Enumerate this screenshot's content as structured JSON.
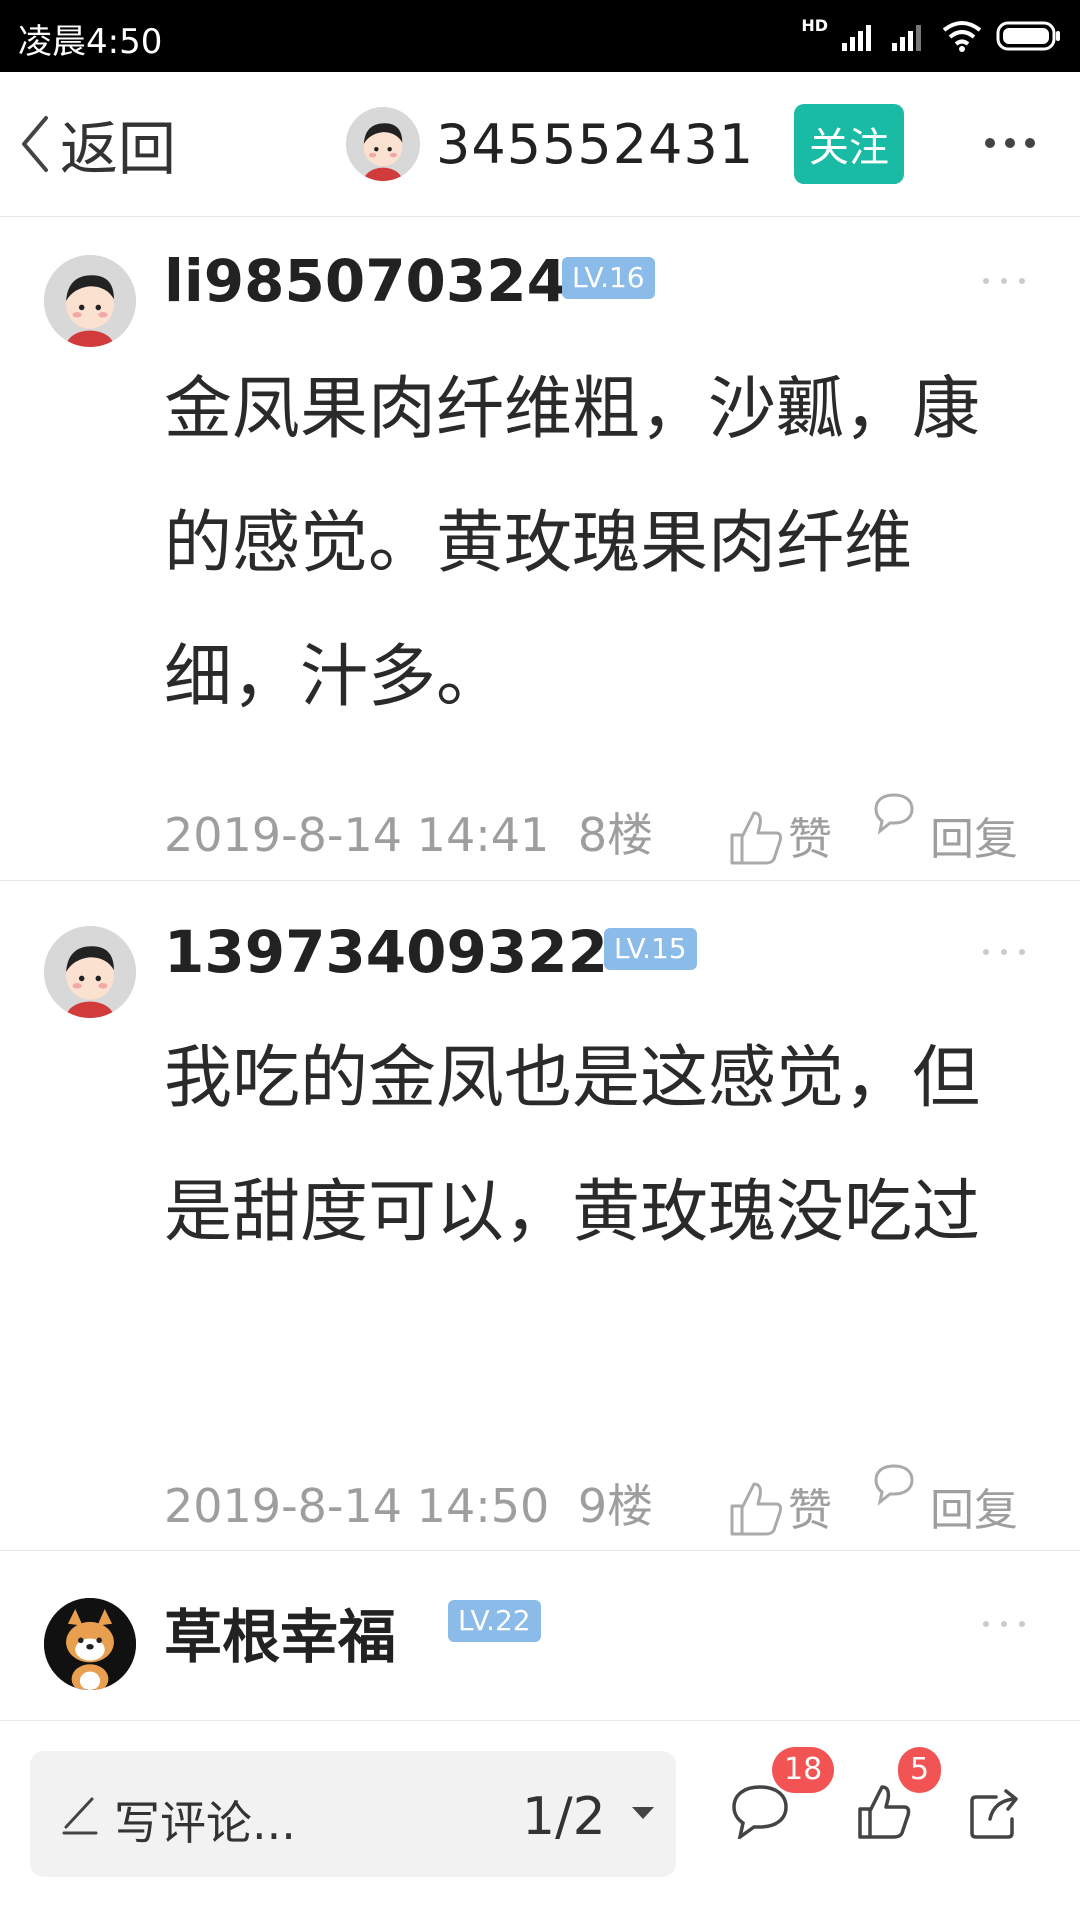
{
  "status_bar": {
    "time": "凌晨4:50",
    "network_label": "HD"
  },
  "header": {
    "back_label": "返回",
    "username": "345552431",
    "follow_label": "关注"
  },
  "comments": [
    {
      "username": "li985070324",
      "level": "LV.16",
      "text": "金凤果肉纤维粗，沙瓤，康的感觉。黄玫瑰果肉纤维细，汁多。",
      "timestamp": "2019-8-14 14:41",
      "floor": "8楼",
      "like_label": "赞",
      "reply_label": "回复"
    },
    {
      "username": "13973409322",
      "level": "LV.15",
      "text": "我吃的金凤也是这感觉，但是甜度可以，黄玫瑰没吃过",
      "timestamp": "2019-8-14 14:50",
      "floor": "9楼",
      "like_label": "赞",
      "reply_label": "回复"
    },
    {
      "username": "草根幸福",
      "level": "LV.22"
    }
  ],
  "bottom_bar": {
    "compose_placeholder": "写评论...",
    "page_indicator": "1/2",
    "comment_count": "18",
    "like_count": "5"
  },
  "colors": {
    "follow_button": "#19bba4",
    "level_badge": "#8bbbe9",
    "count_badge": "#f25454"
  },
  "icons": [
    "back-chevron-icon",
    "more-icon",
    "thumbs-up-icon",
    "speech-bubble-icon",
    "pen-icon",
    "caret-down-icon",
    "share-icon",
    "wifi-icon",
    "signal-icon",
    "battery-icon"
  ]
}
